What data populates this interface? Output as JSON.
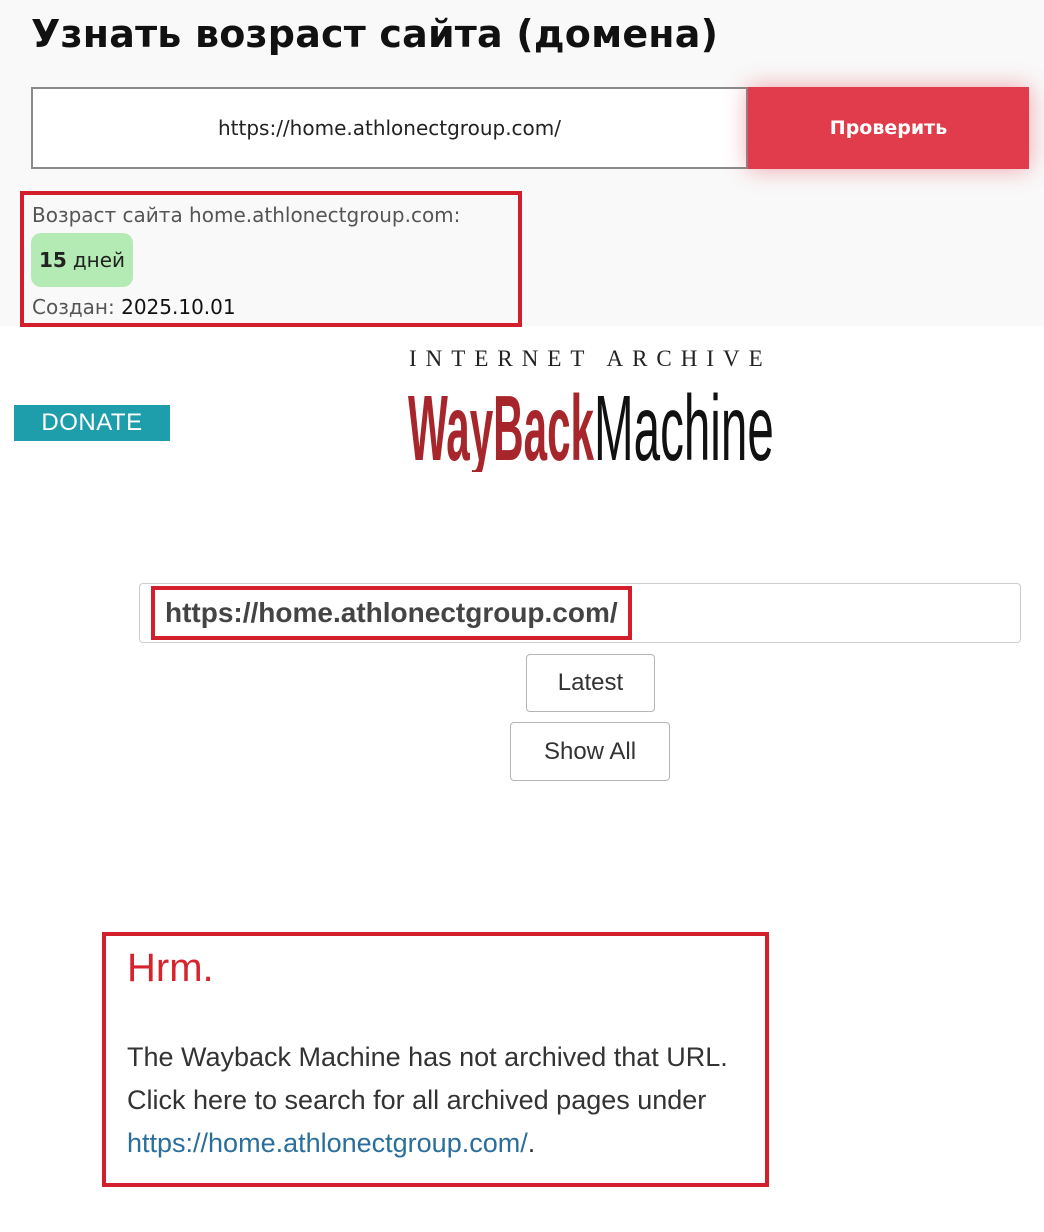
{
  "checker": {
    "title": "Узнать возраст сайта (домена)",
    "url_value": "https://home.athlonectgroup.com/",
    "check_button": "Проверить",
    "result": {
      "age_label": "Возраст сайта home.athlonectgroup.com:",
      "age_number": "15",
      "age_unit": "дней",
      "created_label": "Создан:",
      "created_value": "2025.10.01"
    },
    "colors": {
      "button": "#e03c4c",
      "badge": "#b4ebb4",
      "highlight": "#d21f2b"
    }
  },
  "wayback": {
    "donate_label": "DONATE",
    "logo_top": "INTERNET ARCHIVE",
    "logo_wayback": "WayBack",
    "logo_machine": "Machine",
    "search_url": "https://home.athlonectgroup.com/",
    "latest_label": "Latest",
    "show_all_label": "Show All",
    "message": {
      "title": "Hrm.",
      "line1": "The Wayback Machine has not archived that URL.",
      "line2": "Click here to search for all archived pages under",
      "link": "https://home.athlonectgroup.com/",
      "link_suffix": "."
    },
    "colors": {
      "donate": "#1e9dab",
      "logo_red": "#a7262b",
      "link": "#2a6e9c"
    }
  }
}
